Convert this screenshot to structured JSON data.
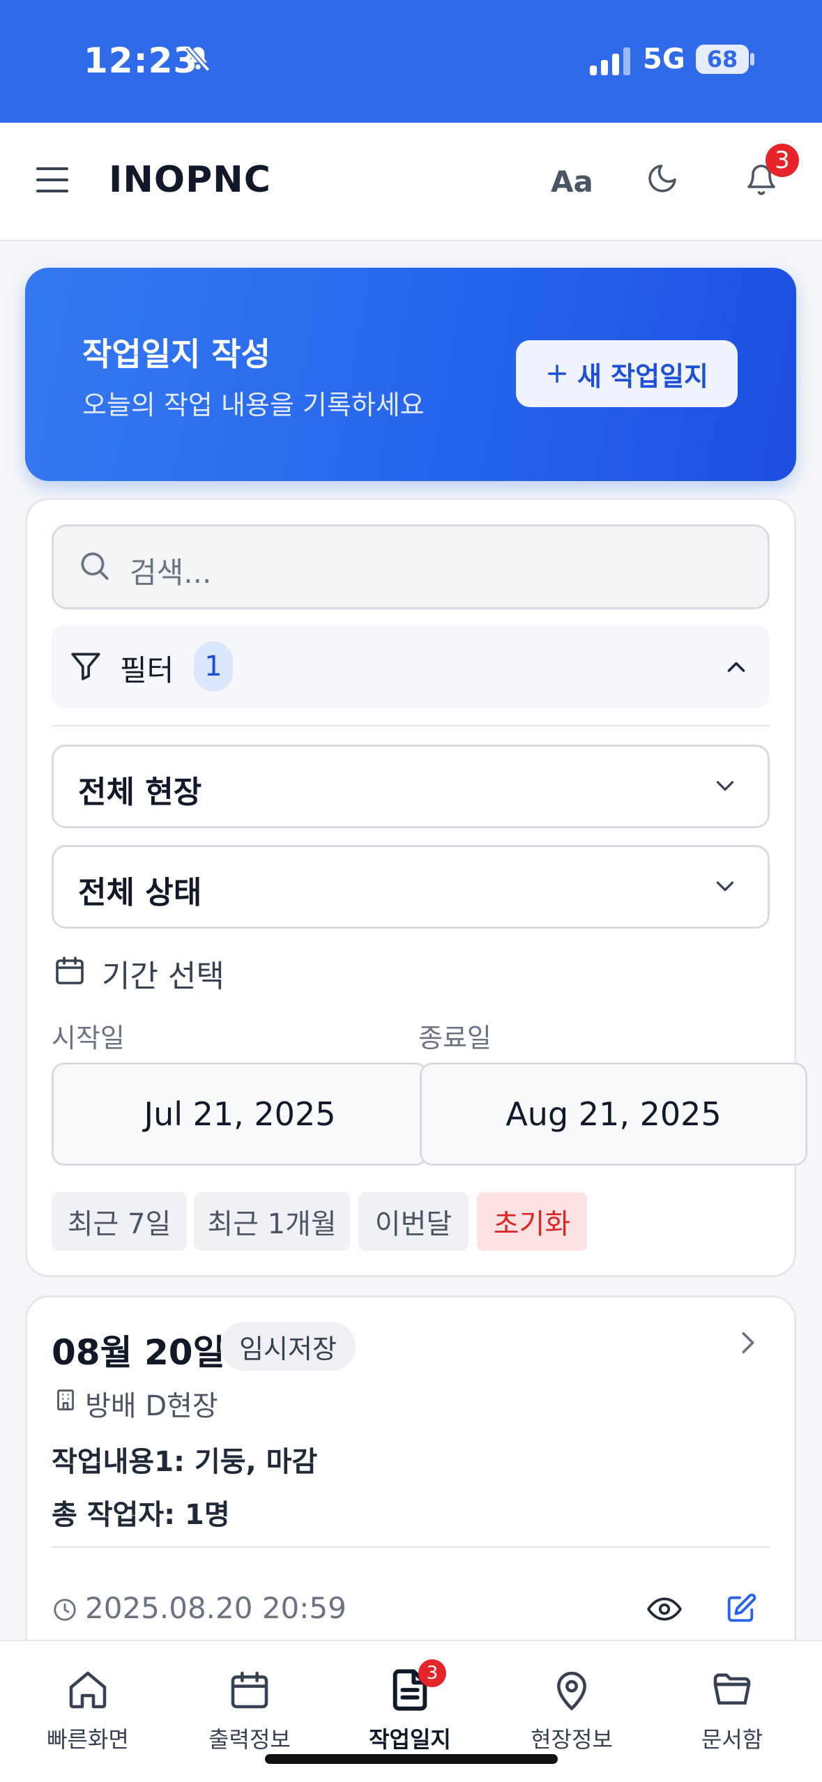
{
  "status_bar": {
    "time": "12:23",
    "network": "5G",
    "battery": "68"
  },
  "header": {
    "brand": "INOPNC",
    "font_button": "Aa",
    "notification_count": "3"
  },
  "banner": {
    "title": "작업일지 작성",
    "subtitle": "오늘의 작업 내용을 기록하세요",
    "new_button": "새 작업일지"
  },
  "search": {
    "placeholder": "검색..."
  },
  "filter": {
    "label": "필터",
    "count": "1",
    "site_select": "전체 현장",
    "status_select": "전체 상태",
    "period_label": "기간 선택",
    "start_label": "시작일",
    "end_label": "종료일",
    "start_date": "Jul 21, 2025",
    "end_date": "Aug 21, 2025",
    "chips": [
      "최근 7일",
      "최근 1개월",
      "이번달",
      "초기화"
    ]
  },
  "entry": {
    "date": "08월 20일",
    "status": "임시저장",
    "site": "방배 D현장",
    "work": "작업내용1: 기둥, 마감",
    "workers": "총 작업자: 1명",
    "timestamp": "2025.08.20 20:59"
  },
  "nav": {
    "items": [
      "빠른화면",
      "출력정보",
      "작업일지",
      "현장정보",
      "문서함"
    ],
    "active": "작업일지",
    "badge": "3"
  },
  "colors": {
    "primary": "#2563eb",
    "danger": "#e5252a",
    "reset_chip": "#dc2626"
  }
}
